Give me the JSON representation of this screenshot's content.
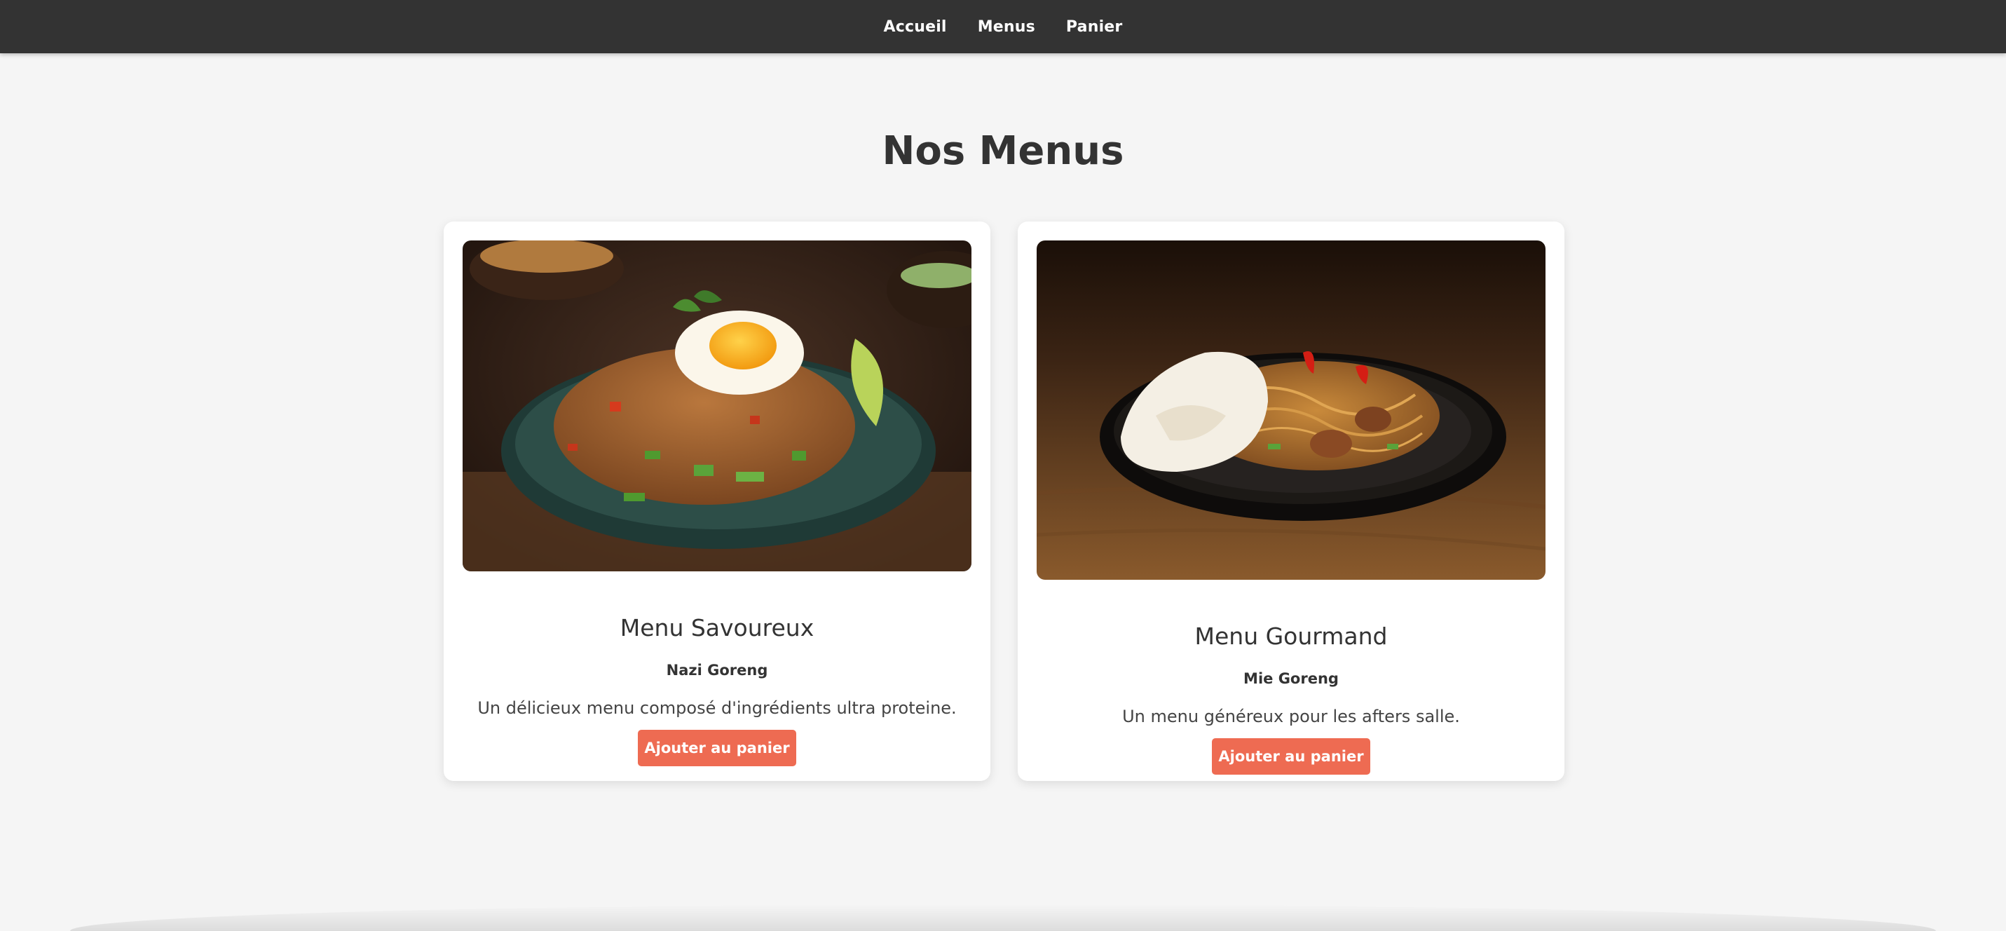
{
  "nav": {
    "items": [
      "Accueil",
      "Menus",
      "Panier"
    ]
  },
  "page": {
    "title": "Nos Menus"
  },
  "cards": [
    {
      "title": "Menu Savoureux",
      "dish": "Nazi Goreng",
      "description": "Un délicieux menu composé d'ingrédients ultra proteine.",
      "button": "Ajouter au panier",
      "image_alt": "fried-rice-image"
    },
    {
      "title": "Menu Gourmand",
      "dish": "Mie Goreng",
      "description": "Un menu généreux pour les afters salle.",
      "button": "Ajouter au panier",
      "image_alt": "fried-noodles-image"
    }
  ],
  "colors": {
    "navbar": "#333333",
    "background": "#f5f5f5",
    "accent": "#ee6b52"
  }
}
